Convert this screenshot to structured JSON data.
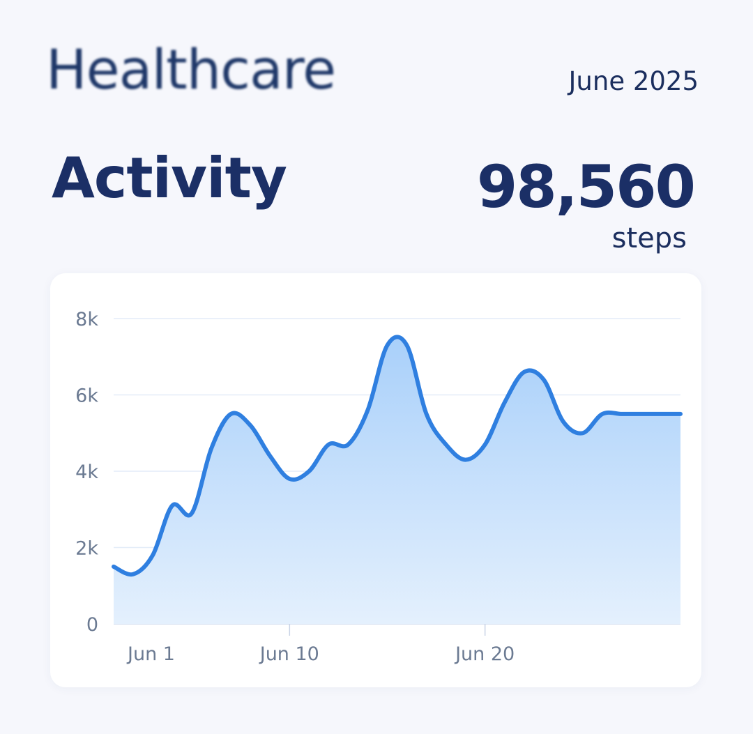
{
  "header": {
    "brand": "Healthcare",
    "period": "June 2025"
  },
  "summary": {
    "title": "Activity",
    "total": "98,560",
    "unit": "steps"
  },
  "colors": {
    "line": "#2f7fe0",
    "area_top": "#a9d0fa",
    "area_bottom": "#e4f0fd",
    "text_dark": "#1b2f66",
    "axis_text": "#6b7a92",
    "grid": "#e3ecf8"
  },
  "chart_data": {
    "type": "area",
    "title": "",
    "xlabel": "",
    "ylabel": "",
    "x": [
      "Jun 1",
      "Jun 2",
      "Jun 3",
      "Jun 4",
      "Jun 5",
      "Jun 6",
      "Jun 7",
      "Jun 8",
      "Jun 9",
      "Jun 10",
      "Jun 11",
      "Jun 12",
      "Jun 13",
      "Jun 14",
      "Jun 15",
      "Jun 16",
      "Jun 17",
      "Jun 18",
      "Jun 19",
      "Jun 20",
      "Jun 21",
      "Jun 22",
      "Jun 23",
      "Jun 24",
      "Jun 25",
      "Jun 26",
      "Jun 27",
      "Jun 28",
      "Jun 29",
      "Jun 30"
    ],
    "series": [
      {
        "values": [
          1500,
          1300,
          1800,
          3100,
          2900,
          4600,
          5500,
          5200,
          4400,
          3800,
          4000,
          4700,
          4700,
          5600,
          7300,
          7300,
          5500,
          4700,
          4300,
          4700,
          5800,
          6600,
          6400,
          5300,
          5000,
          5500,
          5500,
          5500,
          5500,
          5500
        ]
      }
    ],
    "y_ticks": [
      0,
      2000,
      4000,
      6000,
      8000
    ],
    "y_tick_labels": [
      "0",
      "2k",
      "4k",
      "6k",
      "8k"
    ],
    "x_ticks": [
      "Jun 1",
      "Jun 10",
      "Jun 20"
    ],
    "ylim": [
      0,
      8000
    ],
    "grid": true,
    "legend": "none"
  }
}
